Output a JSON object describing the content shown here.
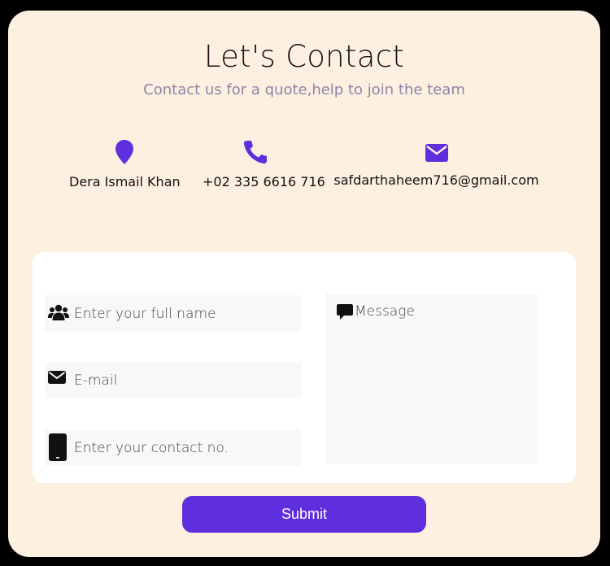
{
  "header": {
    "title": "Let's Contact",
    "subtitle": "Contact us for a quote,help to join the team"
  },
  "info": {
    "location": {
      "icon": "map-pin-icon",
      "text": "Dera Ismail Khan"
    },
    "phone": {
      "icon": "phone-icon",
      "text": "+02 335 6616 716"
    },
    "email": {
      "icon": "envelope-icon",
      "text": "safdarthaheem716@gmail.com"
    }
  },
  "form": {
    "name": {
      "icon": "users-icon",
      "placeholder": "Enter your full name",
      "value": ""
    },
    "email": {
      "icon": "envelope-icon",
      "placeholder": "E-mail",
      "value": ""
    },
    "contact": {
      "icon": "mobile-phone-icon",
      "placeholder": "Enter your contact no.",
      "value": ""
    },
    "message": {
      "icon": "comment-icon",
      "placeholder": "Message",
      "value": ""
    },
    "submit_label": "Submit"
  },
  "colors": {
    "accent": "#5f2ede",
    "card_background": "#fef0e1",
    "page_background": "#000000",
    "field_background": "#f8f8fa",
    "subtitle": "#8b86a6"
  }
}
